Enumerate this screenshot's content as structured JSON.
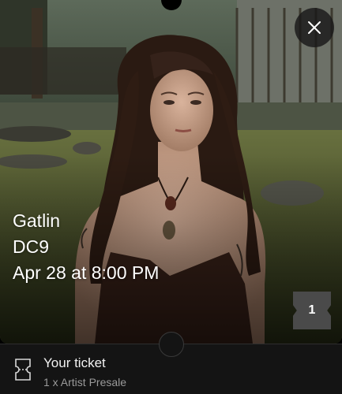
{
  "close_button": {
    "icon": "close-icon"
  },
  "event": {
    "title": "Gatlin",
    "venue": "DC9",
    "datetime": "Apr 28 at 8:00 PM"
  },
  "ticket_badge": {
    "count": "1"
  },
  "ticket_summary": {
    "icon": "ticket-icon",
    "heading": "Your ticket",
    "detail": "1 x Artist Presale"
  },
  "colors": {
    "background": "#000000",
    "footer": "#141414",
    "badge": "#4a4a4a",
    "muted_text": "#9a9a9a"
  }
}
